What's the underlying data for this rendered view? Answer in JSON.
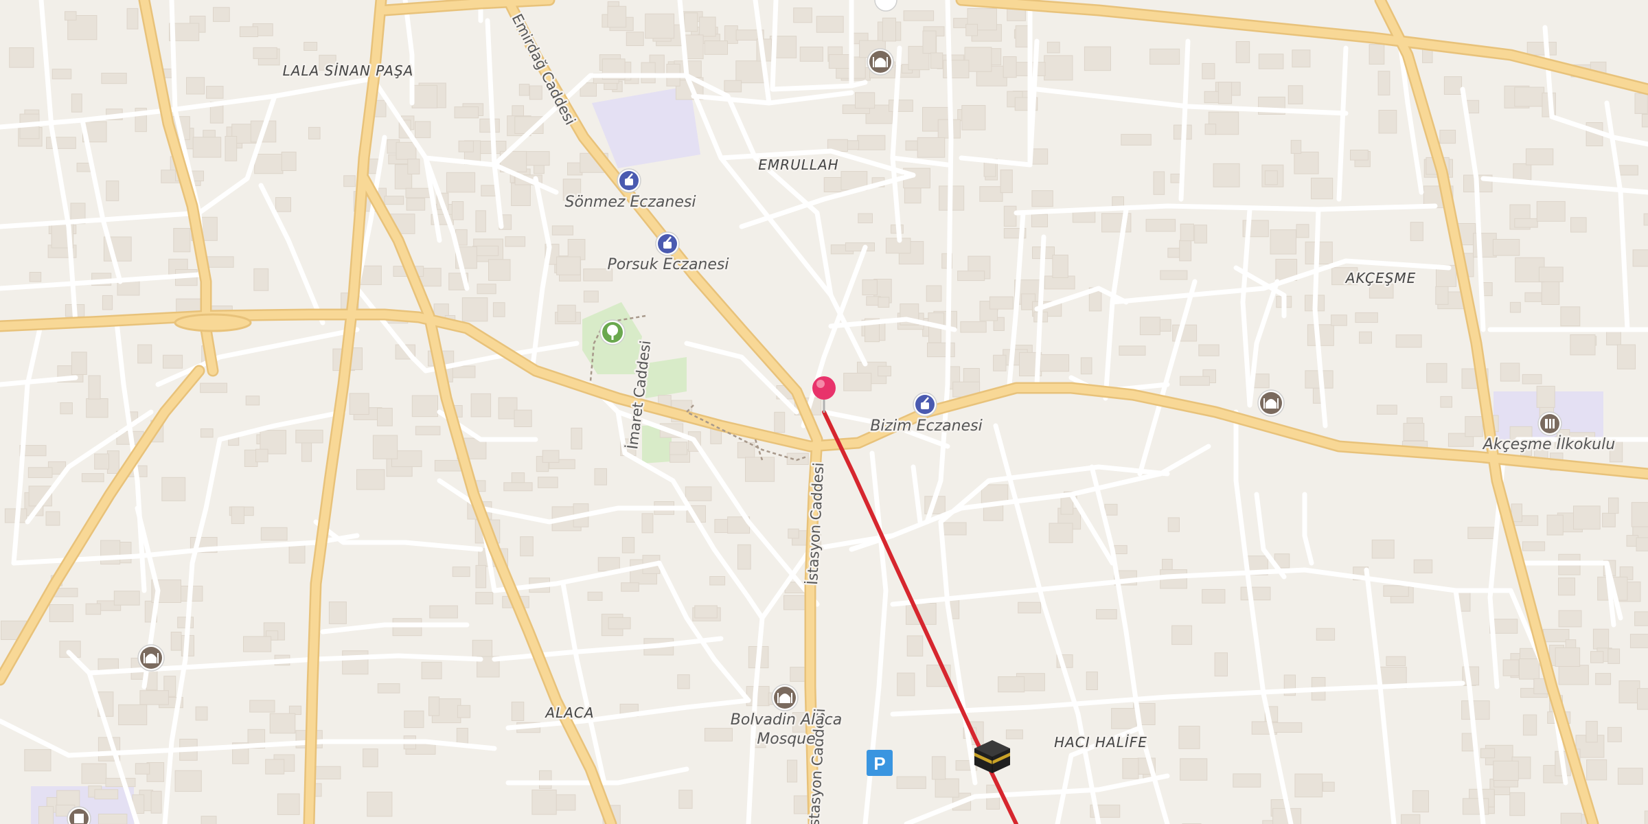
{
  "map": {
    "place_labels": {
      "lala_sinan_pasa": "LALA SİNAN PAŞA",
      "emrullah": "EMRULLAH",
      "akcesme": "AKÇEŞME",
      "alaca": "ALACA",
      "haci_halife": "HACI HALİFE"
    },
    "street_labels": {
      "emirdag": "Emirdağ Caddesi",
      "imaret": "İmaret Caddesi",
      "istasyon": "İstasyon Caddesi",
      "istasyon_bottom": "İstasyon Caddesi"
    },
    "poi_labels": {
      "sonmez": "Sönmez Eczanesi",
      "porsuk": "Porsuk Eczanesi",
      "bizim": "Bizim Eczanesi",
      "akcesme_ilkokulu": "Akçeşme İlkokulu",
      "mosque_line1": "Bolvadin Alaca",
      "mosque_line2": "Mosque"
    },
    "icons": [
      "pharmacy-icon",
      "mosque-icon",
      "park-tree-icon",
      "school-icon",
      "parking-icon",
      "kaaba-icon",
      "map-pin-icon"
    ],
    "parking_glyph": "P",
    "colors": {
      "background": "#f2efe9",
      "major_road": "#f8d896",
      "major_road_casing": "#e8c27a",
      "minor_road": "#ffffff",
      "building": "#e8e2d9",
      "park": "#d8ebc8",
      "school_area": "#e4e0f3",
      "route_line": "#d6262e",
      "pin": "#e8336b",
      "pharmacy": "#4a5ab0",
      "mosque": "#7a6a5e",
      "parking": "#3a95e0"
    }
  }
}
